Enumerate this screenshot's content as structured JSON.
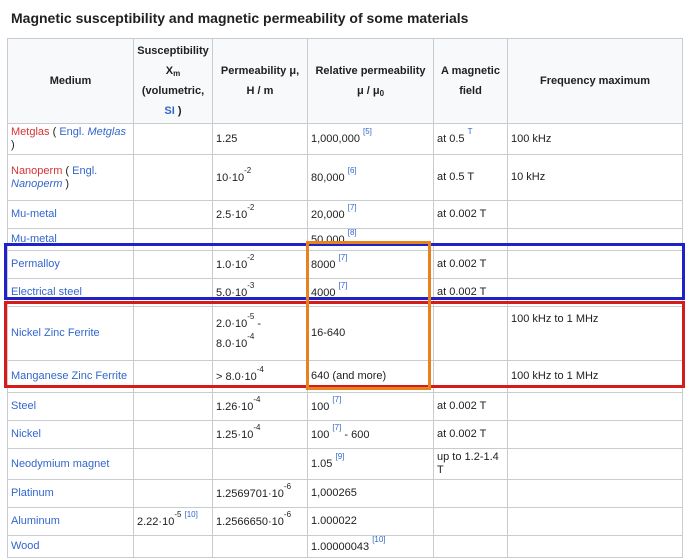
{
  "title": "Magnetic susceptibility and magnetic permeability of some materials",
  "header": {
    "medium": "Medium",
    "susc_1": "Susceptibility",
    "susc_2": "X",
    "susc_sub": "m",
    "susc_3": "(volumetric,",
    "susc_si": "SI",
    "susc_4": ")",
    "perm": "Permeability μ, H / m",
    "rel": "Relative permeability μ / μ",
    "rel_sub": "0",
    "field": "A magnetic field",
    "freq": "Frequency maximum"
  },
  "rows": {
    "metglas": {
      "name": "Metglas",
      "open": " ( ",
      "engl": "Engl.",
      "sp": " ",
      "alt": "Metglas",
      "close": " )",
      "perm": "1.25",
      "rel": "1,000,000",
      "rel_cite": "[5]",
      "field": "at 0.5",
      "field_unit": "T",
      "freq": "100 kHz"
    },
    "nanoperm": {
      "name": "Nanoperm",
      "open": " ( ",
      "engl": "Engl.",
      "alt": "Nanoperm",
      "close": " )",
      "perm_base": "10·10",
      "perm_exp": "-2",
      "rel": "80,000",
      "rel_cite": "[6]",
      "field": "at 0.5 T",
      "freq": "10 kHz"
    },
    "mumetal1": {
      "name": "Mu-metal",
      "perm_base": "2.5·10",
      "perm_exp": "-2",
      "rel": "20,000",
      "rel_cite": "[7]",
      "field": "at 0.002 T"
    },
    "mumetal2": {
      "name": "Mu-metal",
      "rel": "50,000",
      "rel_cite": "[8]"
    },
    "permalloy": {
      "name": "Permalloy",
      "perm_base": "1.0·10",
      "perm_exp": "-2",
      "rel": "8000",
      "rel_cite": "[7]",
      "field": "at 0.002 T"
    },
    "electrical_steel": {
      "name": "Electrical steel",
      "perm_base": "5.0·10",
      "perm_exp": "-3",
      "rel": "4000",
      "rel_cite": "[7]",
      "field": "at 0.002 T"
    },
    "nizn": {
      "name": "Nickel Zinc Ferrite",
      "perm_a_base": "2.0·10",
      "perm_a_exp": "-5",
      "perm_dash": "-",
      "perm_b_base": "8.0·10",
      "perm_b_exp": "-4",
      "rel": "16-640",
      "freq": "100 kHz to 1 MHz"
    },
    "mnzn": {
      "name": "Manganese Zinc Ferrite",
      "perm_prefix": ">",
      "perm_base": "8.0·10",
      "perm_exp": "-4",
      "rel": "640 (and more)",
      "freq": "100 kHz to 1 MHz"
    },
    "steel": {
      "name": "Steel",
      "perm_base": "1.26·10",
      "perm_exp": "-4",
      "rel": "100",
      "rel_cite": "[7]",
      "field": "at 0.002 T"
    },
    "nickel": {
      "name": "Nickel",
      "perm_base": "1.25·10",
      "perm_exp": "-4",
      "rel": "100",
      "rel_cite": "[7]",
      "rel_tail": " - 600",
      "field": "at 0.002 T"
    },
    "neodymium": {
      "name": "Neodymium magnet",
      "rel": "1.05",
      "rel_cite": "[9]",
      "field": "up to 1.2-1.4 T"
    },
    "platinum": {
      "name": "Platinum",
      "perm_base": "1.2569701·10",
      "perm_exp": "-6",
      "rel": "1,000265"
    },
    "aluminum": {
      "name": "Aluminum",
      "susc_base": "2.22·10",
      "susc_exp": "-5",
      "susc_cite": "[10]",
      "perm_base": "1.2566650·10",
      "perm_exp": "-6",
      "rel": "1.000022"
    },
    "wood": {
      "name": "Wood",
      "rel": "1.00000043",
      "rel_cite": "[10]"
    }
  },
  "highlight_colors": {
    "blue": "#1f22c8",
    "red": "#d61b1b",
    "orange": "#e8821e"
  }
}
